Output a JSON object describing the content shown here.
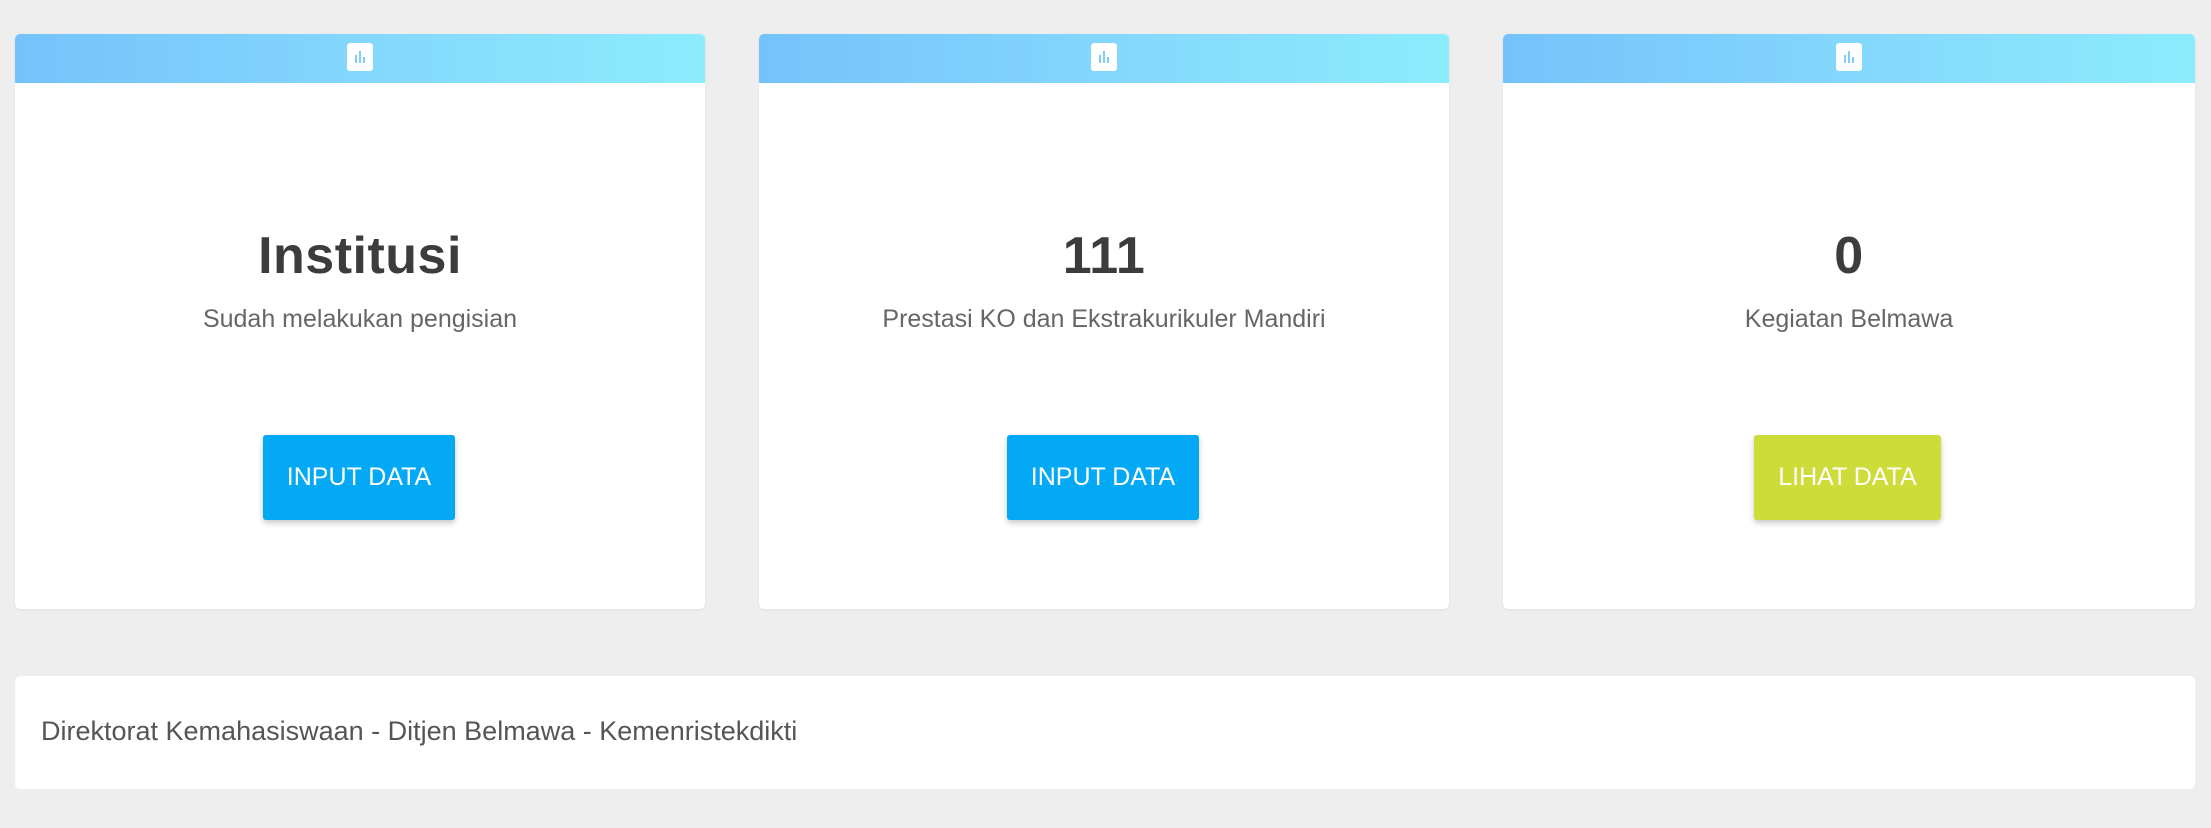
{
  "cards": [
    {
      "value": "Institusi",
      "label": "Sudah melakukan pengisian",
      "button_label": "INPUT DATA",
      "icon": "bar-chart-icon"
    },
    {
      "value": "111",
      "label": "Prestasi KO dan Ekstrakurikuler Mandiri",
      "button_label": "INPUT DATA",
      "icon": "bar-chart-icon"
    },
    {
      "value": "0",
      "label": "Kegiatan Belmawa",
      "button_label": "LIHAT DATA",
      "icon": "bar-chart-icon"
    }
  ],
  "footer": {
    "text": "Direktorat Kemahasiswaan - Ditjen Belmawa - Kemenristekdikti"
  },
  "colors": {
    "background": "#eeeeee",
    "header_gradient_start": "#74c2fb",
    "header_gradient_end": "#8cecfd",
    "input_button": "#03a9f4",
    "lihat_button": "#cddc39",
    "value_text": "#3c3c3c",
    "label_text": "#666666"
  }
}
